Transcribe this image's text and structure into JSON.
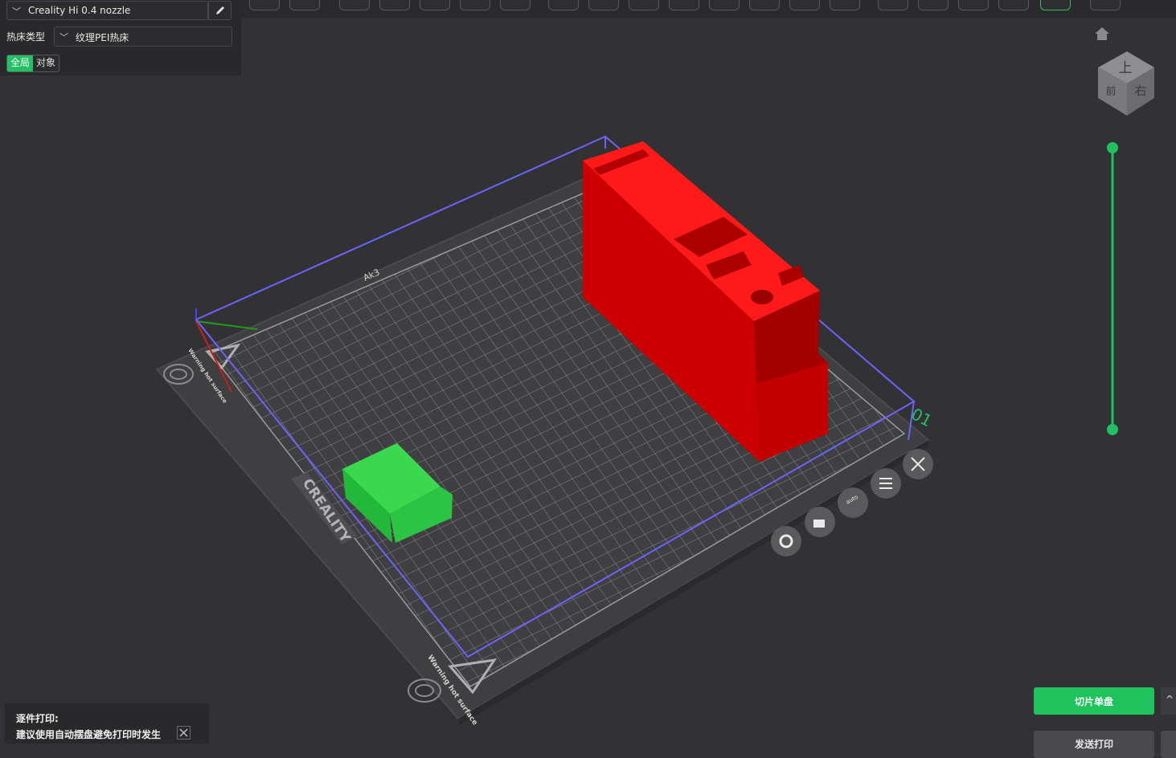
{
  "printer": {
    "name": "Creality Hi 0.4 nozzle"
  },
  "bed": {
    "label": "热床类型",
    "value": "纹理PEI热床"
  },
  "scope": {
    "global": "全局",
    "object": "对象"
  },
  "plate": {
    "brand": "CREALITY",
    "warning_text": "Warning hot surface",
    "plate_number": "01",
    "top_label": "Ak3"
  },
  "view_cube": {
    "top": "上",
    "front": "前",
    "right": "右"
  },
  "plate_tools": {
    "auto_label": "auto"
  },
  "notice": {
    "title": "逐件打印:",
    "body": "建议使用自动摆盘避免打印时发生"
  },
  "actions": {
    "slice": "切片单盘",
    "expand": "^",
    "send": "发送打印"
  },
  "colors": {
    "accent": "#21c062",
    "red_model": "#e00000",
    "green_model": "#35d24c",
    "bounding_box": "#6b63ff"
  }
}
